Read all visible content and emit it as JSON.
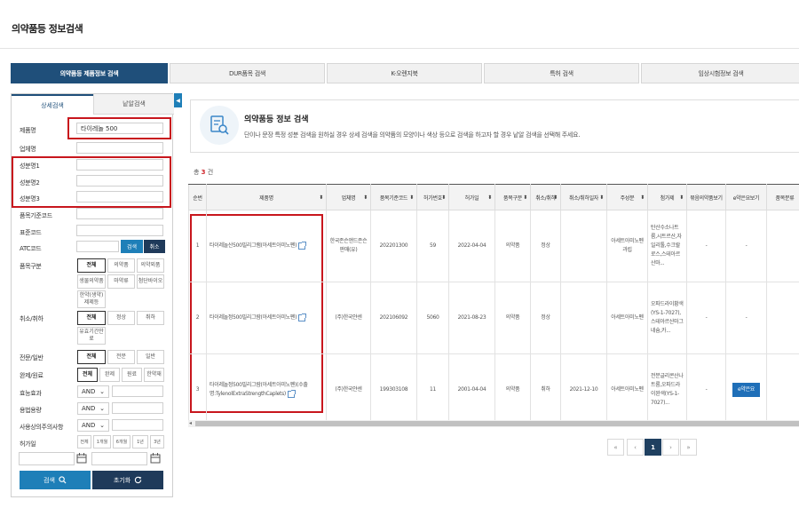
{
  "page": {
    "title": "의약품등 정보검색"
  },
  "topnav": {
    "tabs": [
      {
        "label": "의약품등 제품정보 검색",
        "active": true
      },
      {
        "label": "DUR품목 검색"
      },
      {
        "label": "K-오렌지북"
      },
      {
        "label": "특허 검색"
      },
      {
        "label": "임상시험정보 검색"
      }
    ]
  },
  "left": {
    "tabs": {
      "detail": "상세검색",
      "single": "낱알검색"
    },
    "fields": {
      "product_name": "제품명",
      "product_name_value": "타이레놀 500",
      "company": "업체명",
      "ingredient1": "성분명1",
      "ingredient2": "성분명2",
      "ingredient3": "성분명3",
      "item_code": "품목기준코드",
      "std_code": "표준코드",
      "atc_code": "ATC코드",
      "atc_search": "검색",
      "atc_cancel": "취소",
      "item_type": "품목구분",
      "cancel": "취소/취하",
      "rx": "전문/일반",
      "finished": "완제/원료",
      "efficacy": "효능효과",
      "dosage": "용법용량",
      "caution": "사용상의주의사항",
      "permit_date": "허가일"
    },
    "item_type_opts": [
      "전체",
      "의약품",
      "의약외품",
      "생물의약품",
      "마약류",
      "첨단바이오",
      "한약(생약)제제등"
    ],
    "cancel_opts": [
      "전체",
      "정상",
      "취하",
      "유효기간만료"
    ],
    "rx_opts": [
      "전체",
      "전문",
      "일반"
    ],
    "finished_opts": [
      "전체",
      "완제",
      "원료",
      "한약재"
    ],
    "and_label": "AND",
    "period_opts": [
      "전체",
      "1개월",
      "6개월",
      "1년",
      "3년"
    ],
    "search_btn": "검색",
    "reset_btn": "초기화"
  },
  "info": {
    "title": "의약품등 정보 검색",
    "desc": "단이나 문장 특정 성분 검색을 원하실 경우 상세 검색을 의약품의 모양이나 색상 등으로 검색을 하고자 할 경우 낱알 검색을 선택해 주세요."
  },
  "count": {
    "prefix": "총 ",
    "num": "3",
    "suffix": " 건"
  },
  "table": {
    "headers": [
      "순번",
      "제품명",
      "업체명",
      "품목기준코드",
      "허가번호",
      "허가일",
      "품목구분",
      "취소/취하",
      "취소/취하일자",
      "주성분",
      "첨가제",
      "묶음의약품보기",
      "e약은요보기",
      "품목분류"
    ],
    "rows": [
      {
        "no": "1",
        "name": "타이레놀산500밀리그램(아세트아미노펜)",
        "company": "한국존슨앤드존슨판매(유)",
        "code": "202201300",
        "permit_no": "59",
        "date": "2022-04-04",
        "type": "의약품",
        "status": "정상",
        "cancel_date": "",
        "ingredient": "아세트아미노펜 과립",
        "additive": "탄산수소나트륨,시트르산,자일리톨,수크랄로스,스테아르산마...",
        "bundle": "-",
        "easy": "-"
      },
      {
        "no": "2",
        "name": "타이레놀정500밀리그람(아세트아미노펜)",
        "company": "(주)한국얀센",
        "code": "202106092",
        "permit_no": "5060",
        "date": "2021-08-23",
        "type": "의약품",
        "status": "정상",
        "cancel_date": "",
        "ingredient": "아세트아미노펜",
        "additive": "오파드라이황색(YS-1-7027),스테아르산마그네슘,카...",
        "bundle": "-",
        "easy": "-"
      },
      {
        "no": "3",
        "name": "타이레놀정500밀리그람(아세트아미노펜)(수출명:TylenolExtraStrengthCaplets)",
        "company": "(주)한국얀센",
        "code": "199303108",
        "permit_no": "11",
        "date": "2001-04-04",
        "type": "의약품",
        "status": "취하",
        "cancel_date": "2021-12-10",
        "ingredient": "아세트아미노펜",
        "additive": "전분글리콘산나트륨,오파드라이완색(YS-1-7027)...",
        "bundle": "-",
        "easy_btn": "e약은요"
      }
    ]
  },
  "pager": {
    "first": "«",
    "prev": "‹",
    "current": "1",
    "next": "›",
    "last": "»"
  }
}
